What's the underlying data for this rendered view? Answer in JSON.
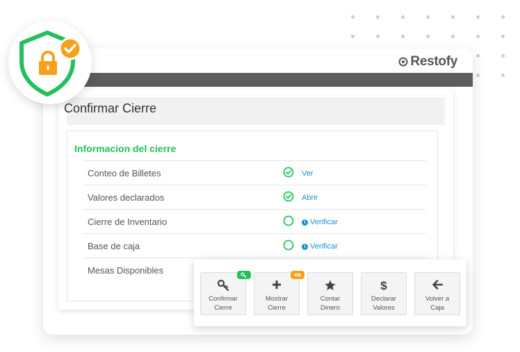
{
  "brand": {
    "name": "Restofy"
  },
  "page": {
    "title": "Confirmar Cierre"
  },
  "section": {
    "title": "Informacion del cierre"
  },
  "rows": [
    {
      "label": "Conteo de Billetes",
      "status": "checked",
      "action": "Ver"
    },
    {
      "label": "Valores declarados",
      "status": "checked",
      "action": "Abrir"
    },
    {
      "label": "Cierre de Inventario",
      "status": "pending",
      "action": "Verificar"
    },
    {
      "label": "Base de caja",
      "status": "pending",
      "action": "Verificar"
    },
    {
      "label": "Mesas Disponibles"
    }
  ],
  "actions": [
    {
      "label": "Confirmar\nCierre",
      "icon": "key-icon",
      "tag": "key-icon",
      "tag_color": "#22c05c"
    },
    {
      "label": "Mostrar\nCierre",
      "icon": "plus-icon",
      "tag": "eye-icon",
      "tag_color": "#f5a21b"
    },
    {
      "label": "Contar\nDinero",
      "icon": "star-icon"
    },
    {
      "label": "Declarar\nValores",
      "icon": "dollar-icon"
    },
    {
      "label": "Volver a\nCaja",
      "icon": "arrow-left-icon"
    }
  ],
  "colors": {
    "accent_green": "#22c05c",
    "link_blue": "#1a8fd6",
    "badge_orange": "#f5a21b",
    "header_dark": "#5d5d5d"
  }
}
